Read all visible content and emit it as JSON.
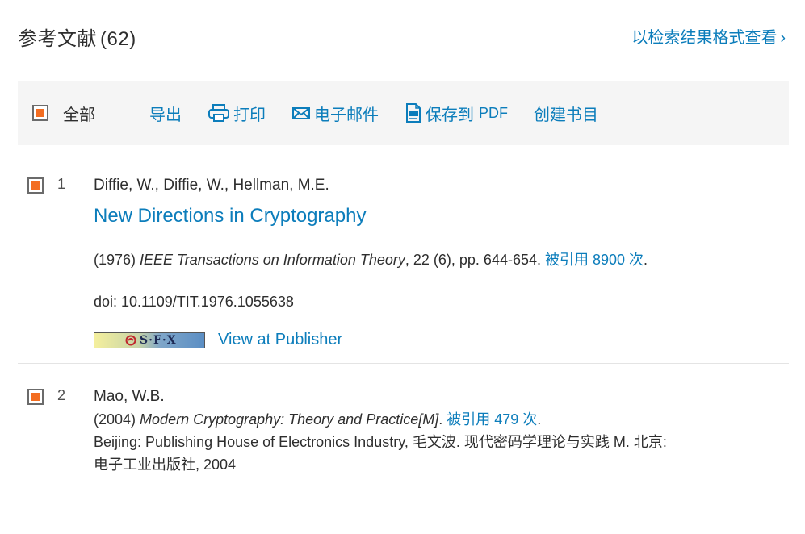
{
  "header": {
    "title": "参考文献",
    "count": "(62)",
    "view_link": "以检索结果格式查看"
  },
  "toolbar": {
    "select_all": "全部",
    "export": "导出",
    "print": "打印",
    "email": "电子邮件",
    "save_pdf": "保存到",
    "save_pdf_suffix": "PDF",
    "bibliography": "创建书目"
  },
  "references": [
    {
      "number": "1",
      "authors": "Diffie, W., Diffie, W., Hellman, M.E.",
      "title": "New Directions in Cryptography",
      "year": "(1976)",
      "journal": "IEEE Transactions on Information Theory",
      "details": ", 22 (6), pp. 644-654. ",
      "cited_by": "被引用 8900 次",
      "cited_suffix": ".",
      "doi": "doi: 10.1109/TIT.1976.1055638",
      "sfx_label": "S·F·X",
      "publisher_link": "View at Publisher"
    },
    {
      "number": "2",
      "authors": "Mao, W.B.",
      "year": "(2004)",
      "source": "Modern Cryptography: Theory and Practice[M]",
      "source_suffix": ". ",
      "cited_by": "被引用 479 次",
      "cited_suffix": ".",
      "extra_line1": "Beijing: Publishing House of Electronics Industry, 毛文波. 现代密码学理论与实践 M. 北京:",
      "extra_line2": "电子工业出版社, 2004"
    }
  ],
  "colors": {
    "link": "#0c7dbb",
    "checkbox_fill": "#f36d21",
    "toolbar_bg": "#f5f5f5"
  }
}
